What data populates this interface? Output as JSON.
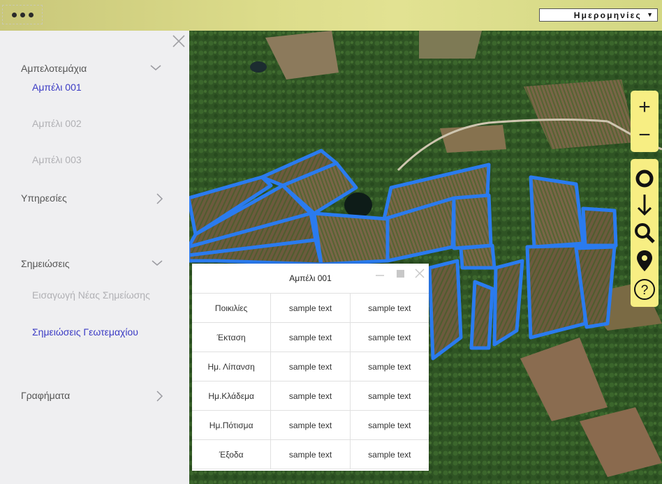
{
  "topbar": {
    "menu_icon": "more-dots-icon",
    "date_select": {
      "label": "Ημερομηνίες",
      "caret": "▼"
    }
  },
  "sidebar": {
    "close_icon": "close-icon",
    "sections": [
      {
        "label": "Αμπελοτεμάχια",
        "icon": "chevron-down-icon",
        "items": [
          {
            "label": "Αμπέλι 001",
            "active": true
          },
          {
            "label": "Αμπέλι 002",
            "active": false
          },
          {
            "label": "Αμπέλι 003",
            "active": false
          }
        ]
      },
      {
        "label": "Υπηρεσίες",
        "icon": "chevron-right-icon",
        "items": []
      },
      {
        "label": "Σημειώσεις",
        "icon": "chevron-down-icon",
        "items": [
          {
            "label": "Εισαγωγή Νέας Σημείωσης",
            "active": false
          },
          {
            "label": "Σημειώσεις Γεωτεμαχίου",
            "active": true
          }
        ]
      },
      {
        "label": "Γραφήματα",
        "icon": "chevron-right-icon",
        "items": []
      }
    ]
  },
  "map_tools": {
    "zoom": [
      {
        "label": "+",
        "icon": "zoom-in-icon"
      },
      {
        "label": "−",
        "icon": "zoom-out-icon"
      }
    ],
    "tools": [
      "circle-icon",
      "arrow-down-icon",
      "search-icon",
      "location-pin-icon",
      "help-icon"
    ]
  },
  "popup": {
    "title": "Αμπέλι 001",
    "controls": [
      "minimize-icon",
      "maximize-icon",
      "close-icon"
    ],
    "rows": [
      {
        "label": "Ποικιλίες",
        "cells": [
          "sample text",
          "sample text"
        ]
      },
      {
        "label": "Έκταση",
        "cells": [
          "sample text",
          "sample text"
        ]
      },
      {
        "label": "Ημ. Λίπανση",
        "cells": [
          "sample text",
          "sample text"
        ]
      },
      {
        "label": "Ημ.Κλάδεμα",
        "cells": [
          "sample text",
          "sample text"
        ]
      },
      {
        "label": "Ημ.Πότισμα",
        "cells": [
          "sample text",
          "sample text"
        ]
      },
      {
        "label": "Έξοδα",
        "cells": [
          "sample text",
          "sample text"
        ]
      }
    ]
  },
  "colors": {
    "parcel_outline": "#2a7bef",
    "toolbar": "#f7ee83",
    "active_link": "#3b3bc4"
  }
}
